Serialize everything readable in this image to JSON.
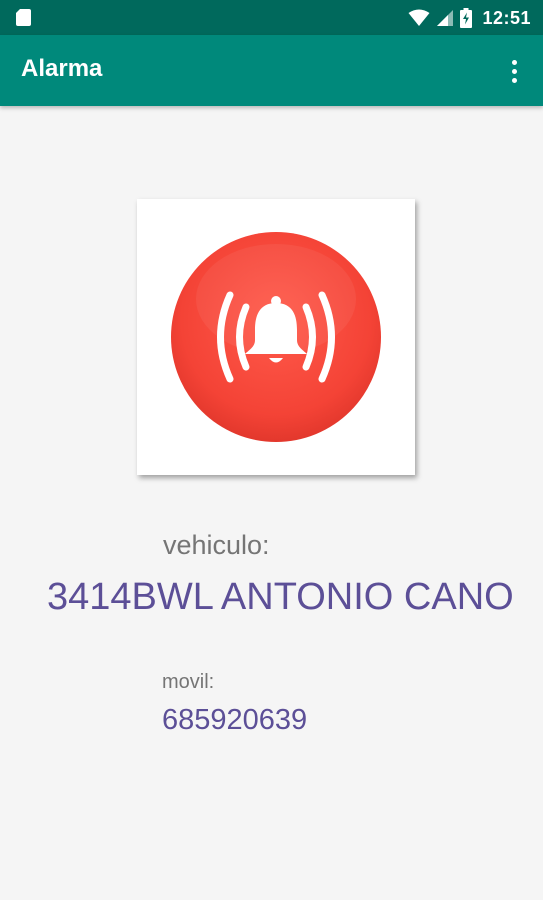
{
  "status_bar": {
    "time": "12:51",
    "icons": [
      "sim-card-icon",
      "wifi-icon",
      "cell-signal-icon",
      "battery-charging-icon"
    ]
  },
  "app_bar": {
    "title": "Alarma",
    "menu_icon": "more-vert-icon"
  },
  "alarm": {
    "icon": "alarm-bell-icon",
    "colors": {
      "button": "#f44336",
      "bell": "#ffffff"
    }
  },
  "vehicle": {
    "label": "vehiculo:",
    "value": "3414BWL ANTONIO CANO"
  },
  "mobile": {
    "label": "movil:",
    "value": "685920639"
  },
  "theme": {
    "primary": "#00897b",
    "primary_dark": "#00695c",
    "value_text": "#5c4f97",
    "label_text": "#757575"
  }
}
